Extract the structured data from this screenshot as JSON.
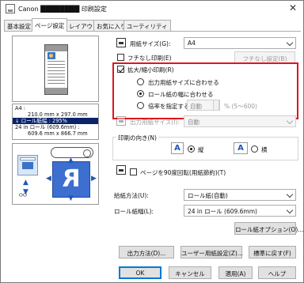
{
  "window": {
    "title": "Canon ████████ 印刷設定",
    "close": "✕"
  },
  "tabs": [
    "基本設定",
    "ページ設定",
    "レイアウト",
    "お気に入り",
    "ユーティリティ"
  ],
  "preview": {
    "media_icon_label": "ᴼᴼ"
  },
  "info": {
    "line1": "A4 :",
    "line2": "210.0 mm x 297.0 mm",
    "line3": "ロール紙幅 : 295%",
    "line4": "24 in ロール (609.6mm) :",
    "line5": "609.6 mm x 866.7 mm"
  },
  "paper_size": {
    "label": "用紙サイズ(G):",
    "value": "A4"
  },
  "borderless": {
    "label": "フチなし印刷(E)",
    "checked": false,
    "button": "フチなし設定(B)"
  },
  "scaling": {
    "label": "拡大/縮小印刷(R)",
    "checked": true,
    "opt1": "出力用紙サイズに合わせる",
    "opt2": "ロール紙の幅に合わせる",
    "opt3": "倍率を指定する",
    "selected": 2,
    "ratio_value": "自動",
    "ratio_unit": "% (5〜600)"
  },
  "output_size": {
    "label": "出力用紙サイズ(I):",
    "value": "自動"
  },
  "orientation": {
    "label": "印刷の向き(N)",
    "portrait": "縦",
    "landscape": "横",
    "selected": "portrait"
  },
  "rotate90": {
    "label": "ページを90度回転(用紙節約)(T)",
    "checked": false
  },
  "feed": {
    "label": "給紙方法(U):",
    "value": "ロール紙(自動)"
  },
  "roll_width": {
    "label": "ロール紙幅(L):",
    "value": "24 in ロール (609.6mm)"
  },
  "roll_options_button": "ロール紙オプション(O)...",
  "buttons": {
    "output": "出力方法(D)...",
    "user_size": "ユーザー用紙設定(Z)...",
    "defaults": "標準に戻す(F)"
  },
  "footer": {
    "ok": "OK",
    "cancel": "キャンセル",
    "apply": "適用(A)",
    "help": "ヘルプ"
  }
}
